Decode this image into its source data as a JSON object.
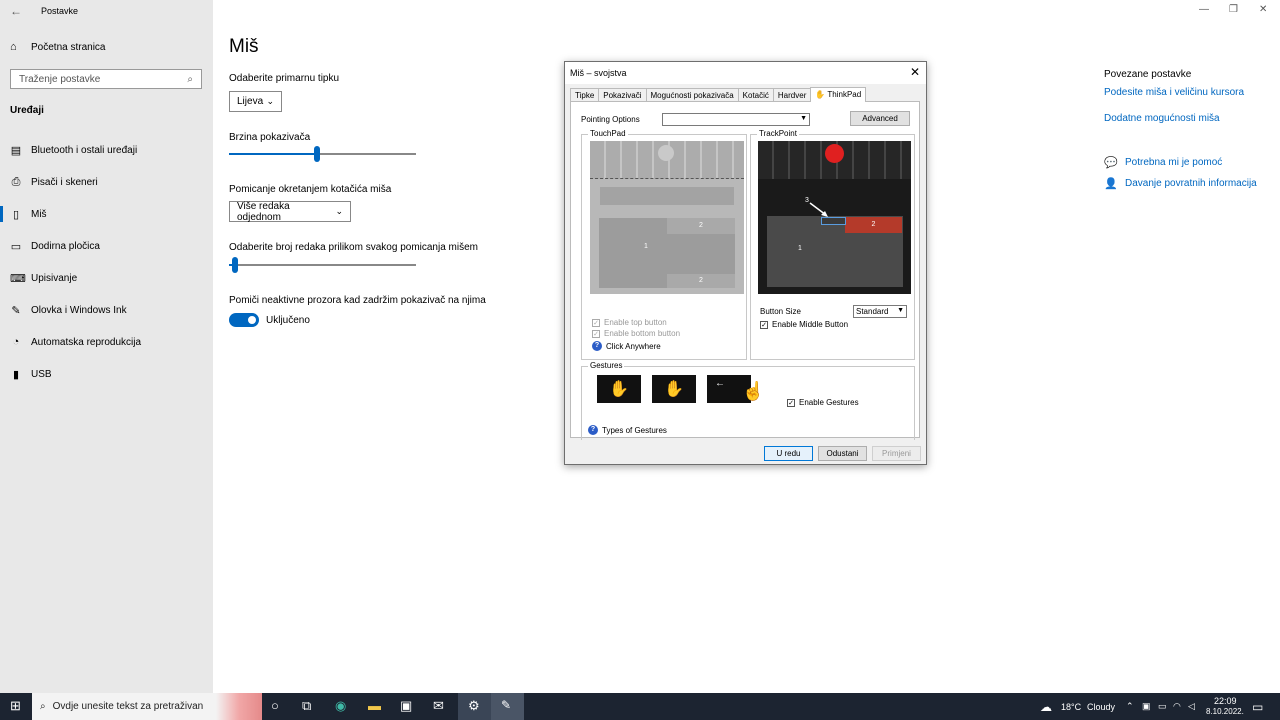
{
  "app": {
    "back_glyph": "←",
    "title": "Postavke"
  },
  "nav": {
    "home": "Početna stranica",
    "search_placeholder": "Traženje postavke",
    "section": "Uređaji",
    "items": [
      {
        "label": "Bluetooth i ostali uređaji",
        "icon": "bluetooth-devices-icon"
      },
      {
        "label": "Pisači i skeneri",
        "icon": "printer-icon"
      },
      {
        "label": "Miš",
        "icon": "mouse-icon",
        "selected": true
      },
      {
        "label": "Dodirna pločica",
        "icon": "touchpad-icon"
      },
      {
        "label": "Upisivanje",
        "icon": "keyboard-icon"
      },
      {
        "label": "Olovka i Windows Ink",
        "icon": "pen-icon"
      },
      {
        "label": "Automatska reprodukcija",
        "icon": "autoplay-icon"
      },
      {
        "label": "USB",
        "icon": "usb-icon"
      }
    ]
  },
  "main": {
    "title": "Miš",
    "primary_button_label": "Odaberite primarnu tipku",
    "primary_button_value": "Lijeva",
    "pointer_speed_label": "Brzina pokazivača",
    "pointer_speed_fraction": 0.47,
    "wheel_label": "Pomicanje okretanjem kotačića miša",
    "wheel_value": "Više redaka odjednom",
    "lines_label": "Odaberite broj redaka prilikom svakog pomicanja mišem",
    "lines_fraction": 0.03,
    "inactive_label": "Pomiči neaktivne prozora kad zadržim pokazivač na njima",
    "inactive_state": "Uključeno"
  },
  "related": {
    "title": "Povezane postavke",
    "link1": "Podesite miša i veličinu kursora",
    "link2": "Dodatne mogućnosti miša",
    "help": "Potrebna mi je pomoć",
    "feedback": "Davanje povratnih informacija"
  },
  "window_controls": {
    "minimize": "—",
    "restore": "❐",
    "close": "✕"
  },
  "dialog": {
    "title": "Miš – svojstva",
    "close": "✕",
    "tabs": [
      "Tipke",
      "Pokazivači",
      "Mogućnosti pokazivača",
      "Kotačić",
      "Hardver",
      "ThinkPad"
    ],
    "pointing_options_label": "Pointing Options",
    "pointing_options_value": "",
    "advanced_button": "Advanced",
    "touchpad_title": "TouchPad",
    "touchpad_zone1": "1",
    "touchpad_zone2_top": "2",
    "touchpad_zone2_bottom": "2",
    "enable_top_button": "Enable top button",
    "enable_bottom_button": "Enable bottom button",
    "click_anywhere": "Click Anywhere",
    "trackpoint_title": "TrackPoint",
    "trackpoint_zone1": "1",
    "trackpoint_zone2": "2",
    "trackpoint_zone3": "3",
    "button_size_label": "Button Size",
    "button_size_value": "Standard",
    "enable_middle_button": "Enable Middle Button",
    "gestures_title": "Gestures",
    "enable_gestures": "Enable Gestures",
    "types_of_gestures": "Types of Gestures",
    "ok_button": "U redu",
    "cancel_button": "Odustani",
    "apply_button": "Primjeni",
    "check_mark": "✓"
  },
  "taskbar": {
    "search_placeholder": "Ovdje unesite tekst za pretraživan",
    "weather_temp": "18°C",
    "weather_text": "Cloudy",
    "time": "22:09",
    "date": "8.10.2022."
  },
  "colors": {
    "accent": "#0067c0",
    "taskbar": "#1c2431",
    "trackpoint_red": "#e02020",
    "trackpoint_zone2": "#b43a2a"
  }
}
